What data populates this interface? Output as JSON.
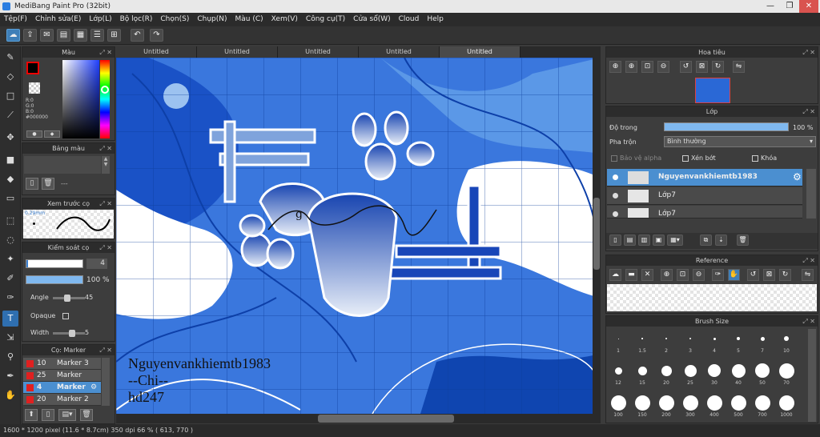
{
  "window": {
    "title": "MediBang Paint Pro (32bit)",
    "min": "—",
    "max": "❐",
    "close": "✕"
  },
  "menu": [
    "Tệp(F)",
    "Chỉnh sửa(E)",
    "Lớp(L)",
    "Bộ lọc(R)",
    "Chọn(S)",
    "Chụp(N)",
    "Màu (C)",
    "Xem(V)",
    "Công cụ(T)",
    "Cửa sổ(W)",
    "Cloud",
    "Help"
  ],
  "tabs": [
    "Untitled",
    "Untitled",
    "Untitled",
    "Untitled",
    "Untitled"
  ],
  "color_panel": {
    "title": "Màu",
    "r": "R:0",
    "g": "G:0",
    "b": "B:0",
    "hex": "#000000"
  },
  "palette_panel": {
    "title": "Bảng màu",
    "dash": "---"
  },
  "preview_panel": {
    "title": "Xem trước cọ",
    "size": "0.29mm"
  },
  "brush_control": {
    "title": "Kiểm soát cọ",
    "size": "4",
    "opacity": "100 %",
    "angle_label": "Angle",
    "angle": "45",
    "opaque_label": "Opaque",
    "width_label": "Width",
    "width": "5"
  },
  "brush_list": {
    "title": "Cọ: Marker",
    "items": [
      {
        "size": "10",
        "name": "Marker 3"
      },
      {
        "size": "25",
        "name": "Marker"
      },
      {
        "size": "4",
        "name": "Marker"
      },
      {
        "size": "20",
        "name": "Marker 2"
      }
    ]
  },
  "navigator": {
    "title": "Hoa tiêu"
  },
  "layer_panel": {
    "title": "Lớp",
    "opacity_label": "Độ trong",
    "opacity": "100 %",
    "blend_label": "Pha trộn",
    "blend": "Bình thường",
    "protect_alpha": "Bảo vệ alpha",
    "clip": "Xén bớt",
    "lock": "Khóa",
    "layers": [
      "Nguyenvankhiemtb1983",
      "Lớp7",
      "Lớp7"
    ]
  },
  "reference": {
    "title": "Reference"
  },
  "brush_size": {
    "title": "Brush Size",
    "sizes": [
      "1",
      "1.5",
      "2",
      "3",
      "4",
      "5",
      "7",
      "10",
      "12",
      "15",
      "20",
      "25",
      "30",
      "40",
      "50",
      "70",
      "100",
      "150",
      "200",
      "300",
      "400",
      "500",
      "700",
      "1000"
    ]
  },
  "canvas": {
    "text1": "Nguyenvankhiemtb1983",
    "text2": "--Chi--",
    "text3": "hd247",
    "letter": "g"
  },
  "status": "1600 * 1200 pixel   (11.6 * 8.7cm)   350 dpi   66 %   ( 613, 770 )",
  "colors": {
    "accent": "#4b8fd0",
    "canvas_blue": "#1b55b8"
  }
}
